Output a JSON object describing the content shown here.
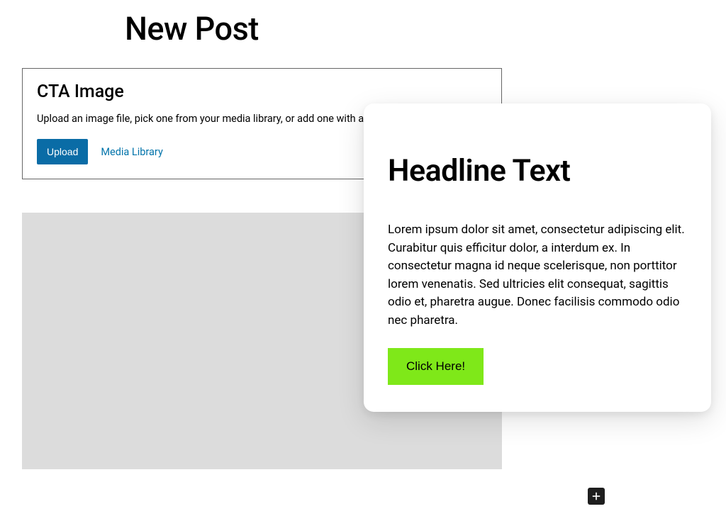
{
  "page": {
    "title": "New Post"
  },
  "cta_block": {
    "title": "CTA Image",
    "description": "Upload an image file, pick one from your media library, or add one with a URL.",
    "upload_label": "Upload",
    "media_library_label": "Media Library"
  },
  "card": {
    "headline": "Headline Text",
    "body": "Lorem ipsum dolor sit amet, consectetur adipiscing elit. Curabitur quis efficitur dolor, a interdum ex. In consectetur magna id neque scelerisque, non porttitor lorem venenatis. Sed ultricies elit consequat, sagittis odio et, pharetra augue. Donec facilisis commodo odio nec pharetra.",
    "button_label": "Click Here!"
  },
  "colors": {
    "primary_button": "#0a6ca6",
    "cta_button": "#7fe819",
    "placeholder_bg": "#dcdcdc"
  }
}
